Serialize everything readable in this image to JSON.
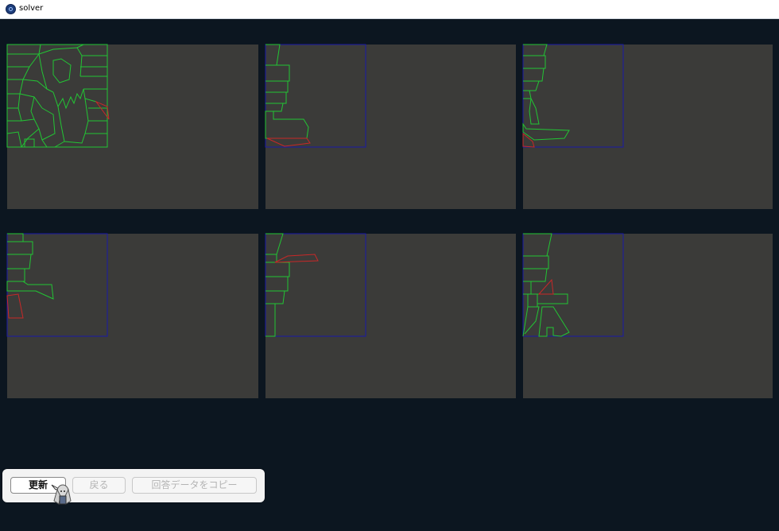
{
  "window": {
    "title": "solver",
    "icon": "app-icon"
  },
  "colors": {
    "background": "#0c1620",
    "panel": "#3b3b39",
    "piece_outline": "#22c534",
    "frame_outline": "#1a1aa8",
    "highlight_piece": "#c82828"
  },
  "panels": [
    {
      "name": "solution-panel-1"
    },
    {
      "name": "solution-panel-2"
    },
    {
      "name": "solution-panel-3"
    },
    {
      "name": "solution-panel-4"
    },
    {
      "name": "solution-panel-5"
    },
    {
      "name": "solution-panel-6"
    }
  ],
  "toolbar": {
    "update_label": "更新",
    "back_label": "戻る",
    "copy_label": "回答データをコピー",
    "back_enabled": false,
    "copy_enabled": false
  },
  "cursor": {
    "icon": "character-cursor-icon"
  }
}
